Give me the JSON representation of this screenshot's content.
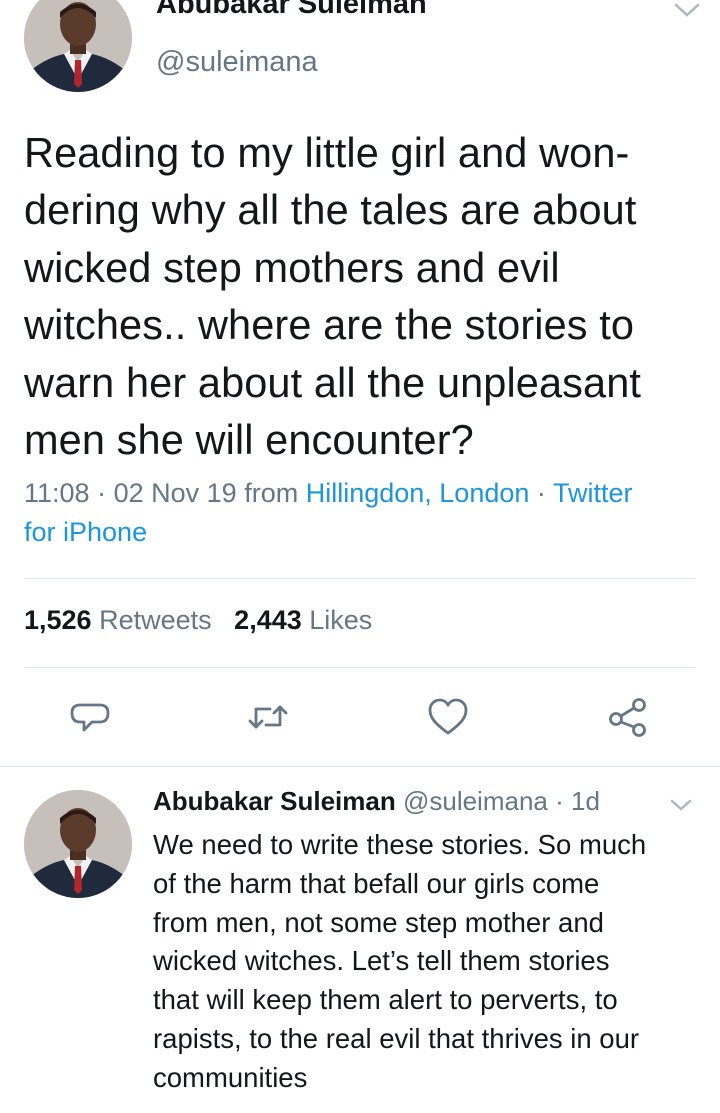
{
  "main_tweet": {
    "author_name": "Abubakar Suleiman",
    "handle": "@suleimana",
    "text_lines": [
      "Reading to my little girl and won-",
      "dering why all the tales are about",
      "wicked step mothers and evil",
      "witches..  where are the stories to",
      "warn her about all the unpleasant",
      "men she will encounter?"
    ],
    "time": "11:08",
    "sep": "·",
    "date": "02 Nov 19",
    "from_label": "from",
    "location": "Hillingdon, London",
    "client_line1": "Twitter",
    "client_line2": "for iPhone",
    "retweets_count": "1,526",
    "retweets_label": "Retweets",
    "likes_count": "2,443",
    "likes_label": "Likes"
  },
  "actions": [
    {
      "icon": "reply-icon"
    },
    {
      "icon": "retweet-icon"
    },
    {
      "icon": "heart-icon"
    },
    {
      "icon": "share-icon"
    }
  ],
  "reply": {
    "author_name": "Abubakar Suleiman",
    "handle": "@suleimana",
    "sep": "·",
    "age": "1d",
    "text_lines": [
      "We need to write these stories.  So much",
      "of the harm that befall our girls come",
      "from men, not some step mother and",
      "wicked witches.  Let’s tell them stories",
      "that will keep them alert to perverts, to",
      "rapists, to the real evil that thrives in our",
      "communities"
    ]
  },
  "colors": {
    "text": "#14171a",
    "secondary": "#657786",
    "link": "#1b95e0",
    "divider": "#e1e8ed",
    "icon": "#657786"
  }
}
